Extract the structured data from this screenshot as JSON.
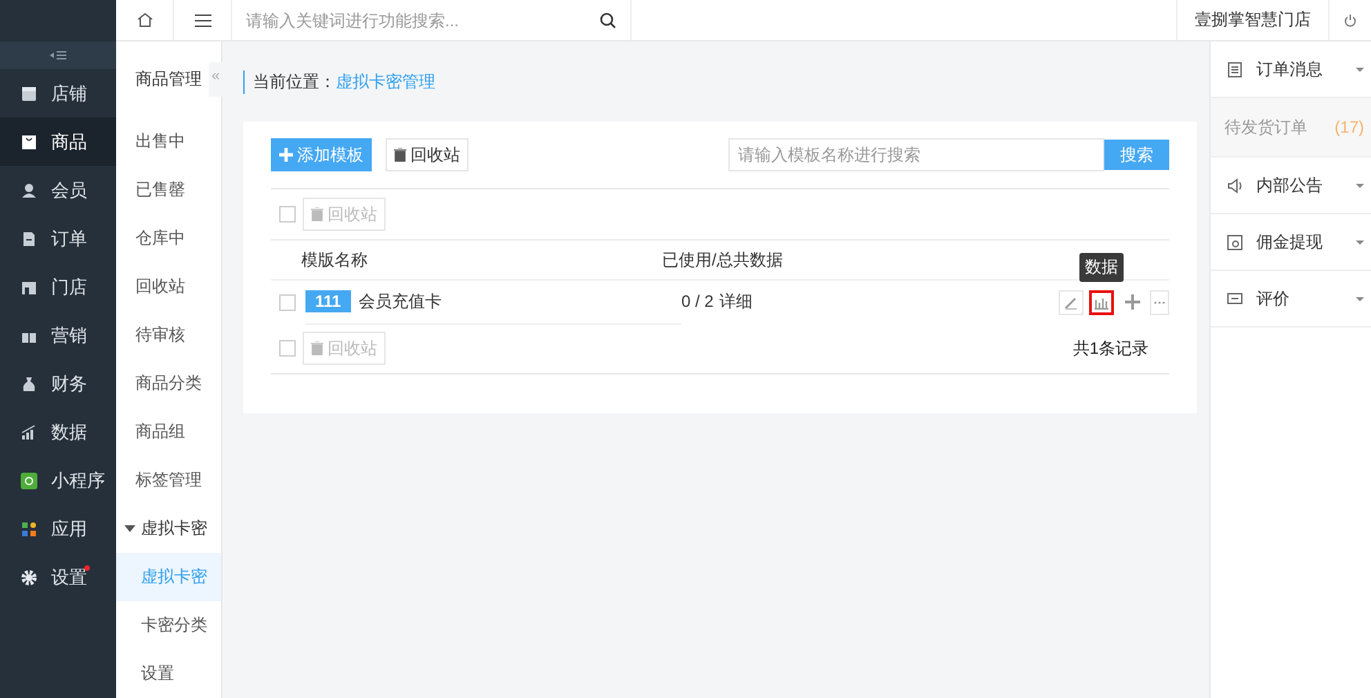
{
  "topbar": {
    "search_placeholder": "请输入关键词进行功能搜索...",
    "store": "壹捌掌智慧门店"
  },
  "nav": [
    {
      "label": "店铺",
      "selected": false,
      "badge": false
    },
    {
      "label": "商品",
      "selected": true,
      "badge": false
    },
    {
      "label": "会员",
      "selected": false,
      "badge": false
    },
    {
      "label": "订单",
      "selected": false,
      "badge": false
    },
    {
      "label": "门店",
      "selected": false,
      "badge": false
    },
    {
      "label": "营销",
      "selected": false,
      "badge": false
    },
    {
      "label": "财务",
      "selected": false,
      "badge": false
    },
    {
      "label": "数据",
      "selected": false,
      "badge": false
    },
    {
      "label": "小程序",
      "selected": false,
      "badge": false
    },
    {
      "label": "应用",
      "selected": false,
      "badge": false
    },
    {
      "label": "设置",
      "selected": false,
      "badge": true
    }
  ],
  "subnav": {
    "title": "商品管理",
    "collapse": "«",
    "items": [
      {
        "label": "出售中",
        "selected": false
      },
      {
        "label": "已售罄",
        "selected": false
      },
      {
        "label": "仓库中",
        "selected": false
      },
      {
        "label": "回收站",
        "selected": false
      },
      {
        "label": "待审核",
        "selected": false
      },
      {
        "label": "商品分类",
        "selected": false
      },
      {
        "label": "商品组",
        "selected": false
      },
      {
        "label": "标签管理",
        "selected": false
      },
      {
        "label": "虚拟卡密",
        "selected": false,
        "expanded": true,
        "children": [
          {
            "label": "虚拟卡密",
            "selected": true
          },
          {
            "label": "卡密分类",
            "selected": false
          },
          {
            "label": "设置",
            "selected": false
          }
        ]
      }
    ]
  },
  "breadcrumb": {
    "label": "当前位置：",
    "link": "虚拟卡密管理"
  },
  "toolbar": {
    "add": "添加模板",
    "recycle": "回收站",
    "search_placeholder": "请输入模板名称进行搜索",
    "search_button": "搜索"
  },
  "batch_top": {
    "checked": false,
    "button": "回收站",
    "disabled": true
  },
  "table": {
    "columns": [
      "模版名称",
      "已使用/总共数据"
    ],
    "rows": [
      {
        "checked": false,
        "tag": "111",
        "name": "会员充值卡",
        "usage": "0 / 2",
        "detail": "详细"
      }
    ]
  },
  "tooltip": "数据",
  "batch_bottom": {
    "checked": false,
    "button": "回收站",
    "disabled": true
  },
  "total": "共1条记录",
  "right_panel": [
    {
      "title": "订单消息",
      "children": [
        {
          "label": "待发货订单",
          "count": "(17)"
        }
      ]
    },
    {
      "title": "内部公告"
    },
    {
      "title": "佣金提现"
    },
    {
      "title": "评价"
    }
  ]
}
